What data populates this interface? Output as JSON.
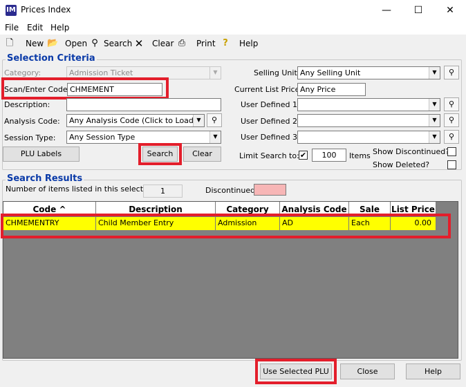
{
  "window": {
    "app_icon": "IM",
    "title": "Prices Index",
    "minimize": "—",
    "maximize": "☐",
    "close": "✕"
  },
  "menu": [
    "File",
    "Edit",
    "Help"
  ],
  "toolbar": {
    "new": "New",
    "open": "Open",
    "search": "Search",
    "clear": "Clear",
    "print": "Print",
    "help": "Help"
  },
  "selection": {
    "title": "Selection Criteria",
    "category_label": "Category:",
    "category_value": "Admission Ticket",
    "scan_label": "Scan/Enter Code:",
    "scan_value": "CHMEMENT",
    "description_label": "Description:",
    "description_value": "",
    "analysis_label": "Analysis Code:",
    "analysis_value": "Any Analysis Code (Click to Load)",
    "session_label": "Session Type:",
    "session_value": "Any Session Type",
    "plu_labels_button": "PLU Labels",
    "search_button": "Search",
    "clear_button": "Clear",
    "selling_unit_label": "Selling Unit:",
    "selling_unit_value": "Any Selling Unit",
    "list_price_label": "Current List Price:",
    "list_price_value": "Any Price",
    "ud1_label": "User Defined 1:",
    "ud2_label": "User Defined 2:",
    "ud3_label": "User Defined 3:",
    "limit_label": "Limit Search to:",
    "limit_value": "100",
    "items_label": "Items",
    "show_discontinued_label": "Show Discontinued?",
    "show_deleted_label": "Show Deleted?"
  },
  "results": {
    "title": "Search Results",
    "count_label": "Number of items listed in this selection:",
    "count_value": "1",
    "discontinued_label": "Discontinued",
    "discontinued_color": "#f7b6b6",
    "columns": [
      "Code ^",
      "Description",
      "Category",
      "Analysis Code",
      "Sale Unit",
      "List Price"
    ],
    "rows": [
      [
        "CHMEMENTRY",
        "Child Member Entry",
        "Admission",
        "AD",
        "Each",
        "0.00"
      ]
    ],
    "selected_row_color": "#ffff00"
  },
  "footer": {
    "use_selected": "Use Selected PLU",
    "close": "Close",
    "help": "Help"
  },
  "colors": {
    "highlight": "#e31e2b",
    "group_title": "#0a3aa8"
  },
  "icons": [
    "app-icon",
    "new-icon",
    "open-folder-icon",
    "binoculars-icon",
    "clear-x-icon",
    "printer-icon",
    "help-question-icon",
    "dropdown-arrow-icon",
    "checkbox-check-icon"
  ]
}
